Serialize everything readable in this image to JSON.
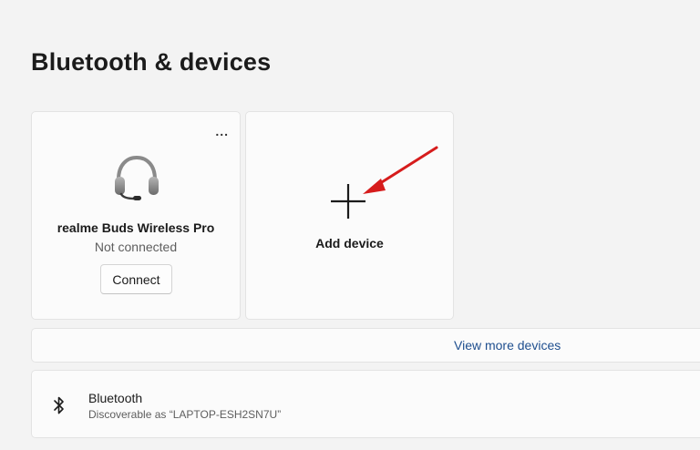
{
  "page": {
    "title": "Bluetooth & devices"
  },
  "device_card": {
    "more_label": "...",
    "icon": "headset-icon",
    "name": "realme Buds Wireless Pro",
    "status": "Not connected",
    "connect_label": "Connect"
  },
  "add_card": {
    "icon": "plus-icon",
    "label": "Add device"
  },
  "annotation": {
    "icon": "red-arrow",
    "color": "#d61c1c"
  },
  "view_more": {
    "label": "View more devices",
    "color": "#1f4f8f"
  },
  "bluetooth": {
    "icon": "bluetooth-icon",
    "title": "Bluetooth",
    "subtitle": "Discoverable as “LAPTOP-ESH2SN7U”"
  }
}
